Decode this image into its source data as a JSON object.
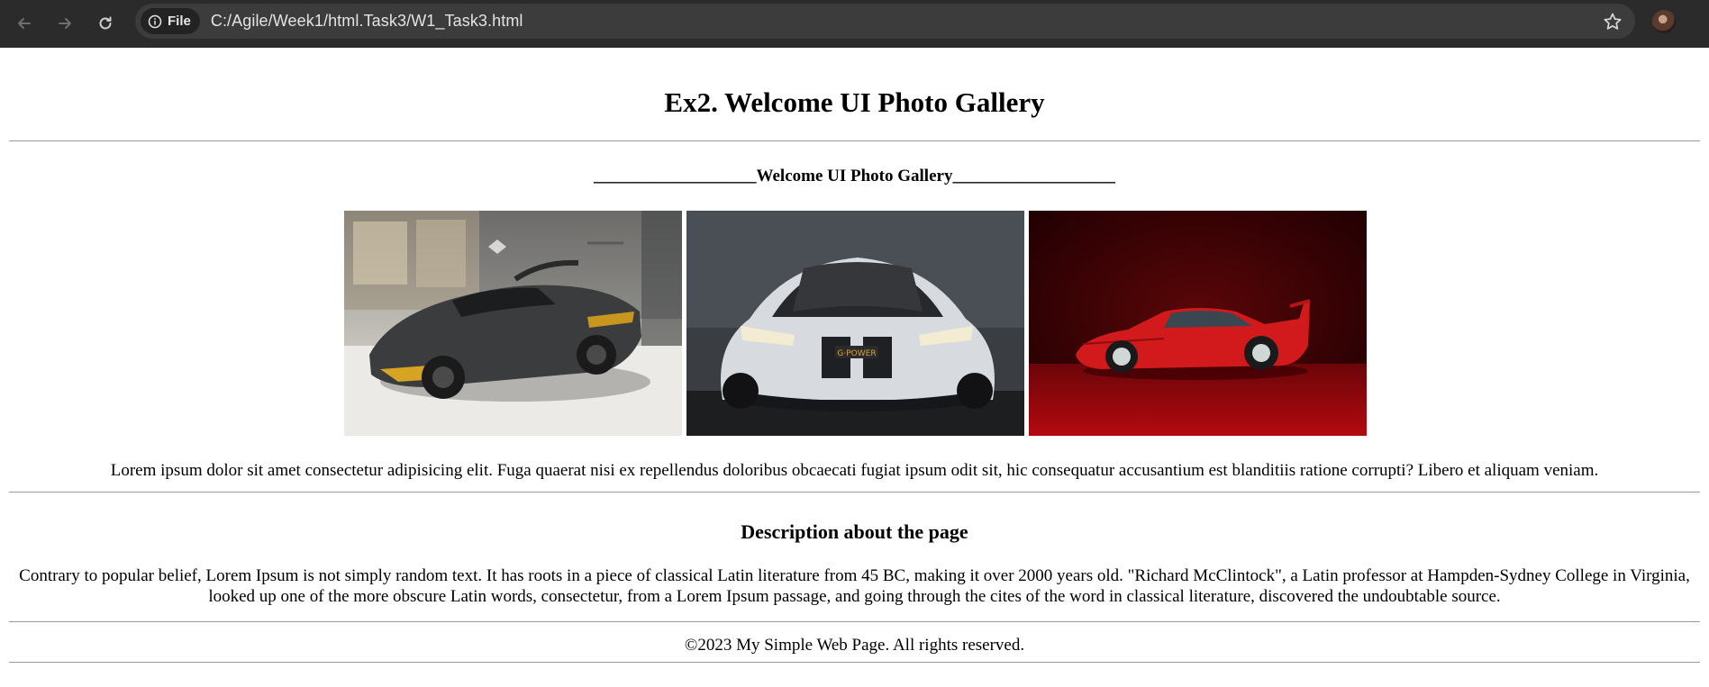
{
  "browser": {
    "file_chip_label": "File",
    "url": "C:/Agile/Week1/html.Task3/W1_Task3.html"
  },
  "page": {
    "title": "Ex2. Welcome UI Photo Gallery",
    "gallery_heading": "___________________Welcome UI Photo Gallery___________________",
    "photos": [
      {
        "subject": "dark carbon supercar in showroom"
      },
      {
        "subject": "silver sports sedan front view"
      },
      {
        "subject": "red classic sports car on red backdrop"
      }
    ],
    "lorem": "Lorem ipsum dolor sit amet consectetur adipisicing elit. Fuga quaerat nisi ex repellendus doloribus obcaecati fugiat ipsum odit sit, hic consequatur accusantium est blanditiis ratione corrupti? Libero et aliquam veniam.",
    "description_heading": "Description about the page",
    "description": "Contrary to popular belief, Lorem Ipsum is not simply random text. It has roots in a piece of classical Latin literature from 45 BC, making it over 2000 years old. \"Richard McClintock\", a Latin professor at Hampden-Sydney College in Virginia, looked up one of the more obscure Latin words, consectetur, from a Lorem Ipsum passage, and going through the cites of the word in classical literature, discovered the undoubtable source.",
    "footer": "©2023 My Simple Web Page. All rights reserved."
  },
  "colors": {
    "chrome_bg": "#2b2b2b",
    "omnibox_bg": "#3c3c3c",
    "page_bg": "#ffffff",
    "rule": "#9a9a9a"
  }
}
